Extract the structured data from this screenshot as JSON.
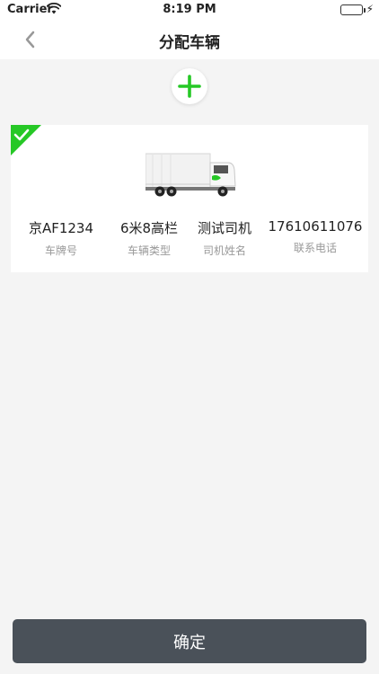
{
  "status_bar": {
    "carrier": "Carrier",
    "time": "8:19 PM",
    "wifi_icon": "wifi-icon",
    "battery_icon": "battery-icon",
    "charging_icon": "bolt-icon",
    "battery_color": "#35c759"
  },
  "nav": {
    "title": "分配车辆",
    "back_icon": "chevron-left-icon"
  },
  "add_button": {
    "icon": "plus-icon",
    "color": "#26c826"
  },
  "vehicle_card": {
    "selected": true,
    "check_color": "#26c826",
    "image": "truck-image",
    "fields": [
      {
        "value": "京AF1234",
        "label": "车牌号"
      },
      {
        "value": "6米8高栏",
        "label": "车辆类型"
      },
      {
        "value": "测试司机",
        "label": "司机姓名"
      },
      {
        "value": "17610611076",
        "label": "联系电话"
      }
    ]
  },
  "confirm_button": {
    "label": "确定",
    "color": "#4a5159"
  }
}
